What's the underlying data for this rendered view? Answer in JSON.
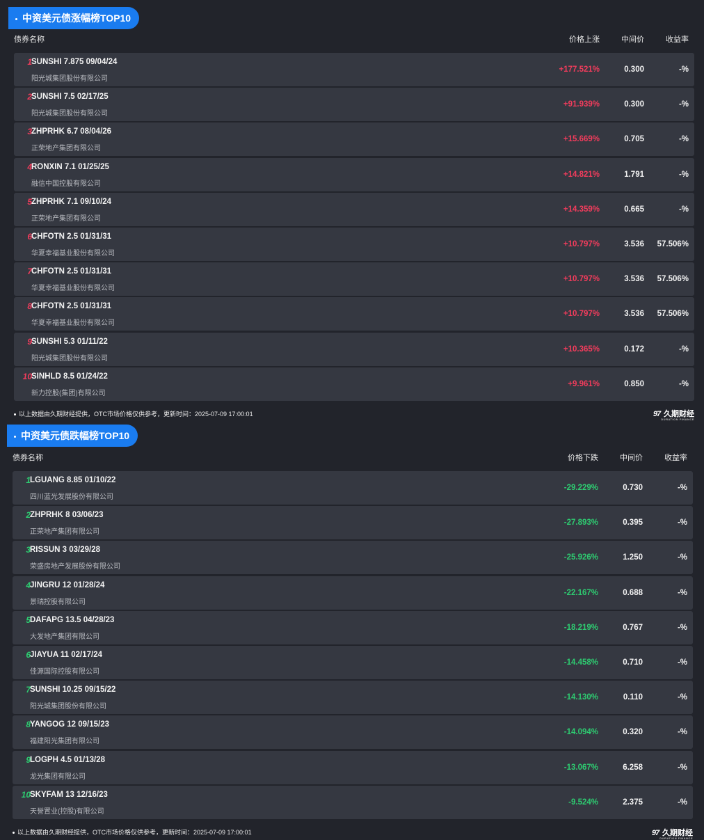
{
  "rise": {
    "title": "中资美元债涨幅榜TOP10",
    "headers": {
      "name": "债券名称",
      "change": "价格上涨",
      "mid": "中间价",
      "yield": "收益率"
    },
    "rows": [
      {
        "rank": "1",
        "bond": "SUNSHI 7.875 09/04/24",
        "issuer": "阳光城集团股份有限公司",
        "change": "+177.521%",
        "mid": "0.300",
        "yield": "-%"
      },
      {
        "rank": "2",
        "bond": "SUNSHI 7.5 02/17/25",
        "issuer": "阳光城集团股份有限公司",
        "change": "+91.939%",
        "mid": "0.300",
        "yield": "-%"
      },
      {
        "rank": "3",
        "bond": "ZHPRHK 6.7 08/04/26",
        "issuer": "正荣地产集团有限公司",
        "change": "+15.669%",
        "mid": "0.705",
        "yield": "-%"
      },
      {
        "rank": "4",
        "bond": "RONXIN 7.1 01/25/25",
        "issuer": "融信中国控股有限公司",
        "change": "+14.821%",
        "mid": "1.791",
        "yield": "-%"
      },
      {
        "rank": "5",
        "bond": "ZHPRHK 7.1 09/10/24",
        "issuer": "正荣地产集团有限公司",
        "change": "+14.359%",
        "mid": "0.665",
        "yield": "-%"
      },
      {
        "rank": "6",
        "bond": "CHFOTN 2.5 01/31/31",
        "issuer": "华夏幸福基业股份有限公司",
        "change": "+10.797%",
        "mid": "3.536",
        "yield": "57.506%"
      },
      {
        "rank": "7",
        "bond": "CHFOTN 2.5 01/31/31",
        "issuer": "华夏幸福基业股份有限公司",
        "change": "+10.797%",
        "mid": "3.536",
        "yield": "57.506%"
      },
      {
        "rank": "8",
        "bond": "CHFOTN 2.5 01/31/31",
        "issuer": "华夏幸福基业股份有限公司",
        "change": "+10.797%",
        "mid": "3.536",
        "yield": "57.506%"
      },
      {
        "rank": "9",
        "bond": "SUNSHI 5.3 01/11/22",
        "issuer": "阳光城集团股份有限公司",
        "change": "+10.365%",
        "mid": "0.172",
        "yield": "-%"
      },
      {
        "rank": "10",
        "bond": "SINHLD 8.5 01/24/22",
        "issuer": "新力控股(集团)有限公司",
        "change": "+9.961%",
        "mid": "0.850",
        "yield": "-%"
      }
    ],
    "footer": "以上数据由久期财经提供，OTC市场价格仅供参考，更新时间：2025-07-09 17:00:01"
  },
  "fall": {
    "title": "中资美元债跌幅榜TOP10",
    "headers": {
      "name": "债券名称",
      "change": "价格下跌",
      "mid": "中间价",
      "yield": "收益率"
    },
    "rows": [
      {
        "rank": "1",
        "bond": "LGUANG 8.85 01/10/22",
        "issuer": "四川蓝光发展股份有限公司",
        "change": "-29.229%",
        "mid": "0.730",
        "yield": "-%"
      },
      {
        "rank": "2",
        "bond": "ZHPRHK 8 03/06/23",
        "issuer": "正荣地产集团有限公司",
        "change": "-27.893%",
        "mid": "0.395",
        "yield": "-%"
      },
      {
        "rank": "3",
        "bond": "RISSUN 3 03/29/28",
        "issuer": "荣盛房地产发展股份有限公司",
        "change": "-25.926%",
        "mid": "1.250",
        "yield": "-%"
      },
      {
        "rank": "4",
        "bond": "JINGRU 12 01/28/24",
        "issuer": "景瑞控股有限公司",
        "change": "-22.167%",
        "mid": "0.688",
        "yield": "-%"
      },
      {
        "rank": "5",
        "bond": "DAFAPG 13.5 04/28/23",
        "issuer": "大发地产集团有限公司",
        "change": "-18.219%",
        "mid": "0.767",
        "yield": "-%"
      },
      {
        "rank": "6",
        "bond": "JIAYUA 11 02/17/24",
        "issuer": "佳源国际控股有限公司",
        "change": "-14.458%",
        "mid": "0.710",
        "yield": "-%"
      },
      {
        "rank": "7",
        "bond": "SUNSHI 10.25 09/15/22",
        "issuer": "阳光城集团股份有限公司",
        "change": "-14.130%",
        "mid": "0.110",
        "yield": "-%"
      },
      {
        "rank": "8",
        "bond": "YANGOG 12 09/15/23",
        "issuer": "福建阳光集团有限公司",
        "change": "-14.094%",
        "mid": "0.320",
        "yield": "-%"
      },
      {
        "rank": "9",
        "bond": "LOGPH 4.5 01/13/28",
        "issuer": "龙光集团有限公司",
        "change": "-13.067%",
        "mid": "6.258",
        "yield": "-%"
      },
      {
        "rank": "10",
        "bond": "SKYFAM 13 12/16/23",
        "issuer": "天誉置业(控股)有限公司",
        "change": "-9.524%",
        "mid": "2.375",
        "yield": "-%"
      }
    ],
    "footer": "以上数据由久期财经提供，OTC市场价格仅供参考，更新时间：2025-07-09 17:00:01"
  },
  "logo": {
    "mark": "97",
    "name": "久期财经",
    "sub": "DURATION FINANCE"
  },
  "colors": {
    "accent": "#1a7cf0",
    "rise": "#f23c5c",
    "fall": "#2ecc71",
    "background": "#22242b",
    "row": "#353841"
  },
  "icons": {
    "logo": "jiuqi-logo-icon",
    "bullet": "bullet-dot-icon"
  }
}
